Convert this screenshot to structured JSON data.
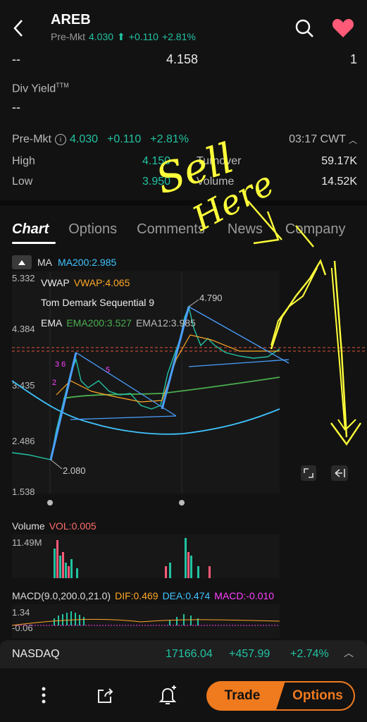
{
  "header": {
    "ticker": "AREB",
    "premkt_label": "Pre-Mkt",
    "premkt_price": "4.030",
    "premkt_change": "+0.110",
    "premkt_pct": "+2.81%"
  },
  "stats": {
    "row1_left": "--",
    "row1_mid": "4.158",
    "row1_right": "1",
    "div_yield_label": "Div Yield",
    "div_yield_sup": "TTM",
    "div_yield_value": "--",
    "premkt_label": "Pre-Mkt",
    "premkt_price": "4.030",
    "premkt_change": "+0.110",
    "premkt_pct": "+2.81%",
    "premkt_time": "03:17 CWT",
    "high_label": "High",
    "high_value": "4.150",
    "turnover_label": "Turnover",
    "turnover_value": "59.17K",
    "low_label": "Low",
    "low_value": "3.950",
    "volume_label": "Volume",
    "volume_value": "14.52K"
  },
  "tabs": [
    "Chart",
    "Options",
    "Comments",
    "News",
    "Company"
  ],
  "chart": {
    "ma_label": "MA",
    "ma_value": "MA200:2.985",
    "vwap_label": "VWAP",
    "vwap_value": "VWAP:4.065",
    "tdseq_label": "Tom Demark Sequential 9",
    "ema_label": "EMA",
    "ema200": "EMA200:3.527",
    "ema12": "EMA12:3.985",
    "y_ticks": [
      "5.332",
      "4.384",
      "3.435",
      "2.486",
      "1.538"
    ],
    "high_annot": "4.790",
    "low_annot": "2.080"
  },
  "annotations": {
    "handwritten_line1": "Sell",
    "handwritten_line2": "Here"
  },
  "volume": {
    "label": "Volume",
    "value": "VOL:0.005",
    "max_tick": "11.49M"
  },
  "macd": {
    "label": "MACD(9.0,200.0,21.0)",
    "dif": "DIF:0.469",
    "dea": "DEA:0.474",
    "macd": "MACD:-0.010",
    "tick_top": "1.34",
    "tick_bottom": "-0.06"
  },
  "ticker_bar": {
    "name": "NASDAQ",
    "value": "17166.04",
    "change": "+457.99",
    "pct": "+2.74%"
  },
  "bottom_nav": {
    "trade": "Trade",
    "options": "Options"
  },
  "colors": {
    "bg": "#121212",
    "green": "#22c3a3",
    "orange": "#f07a1e",
    "ma": "#40c4ff",
    "vwap": "#ffa726",
    "ema200": "#4caf50",
    "yellow": "#ffff3a"
  }
}
